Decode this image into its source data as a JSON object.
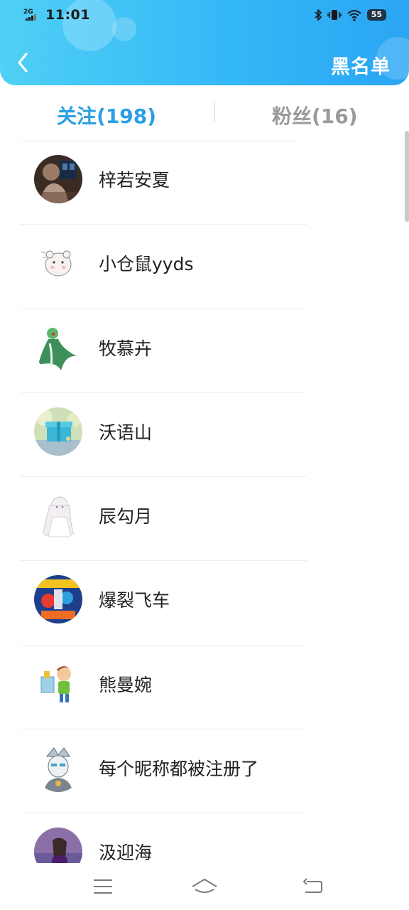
{
  "status_bar": {
    "network": "2G",
    "time": "11:01",
    "battery": "55",
    "icons": [
      "signal-icon",
      "bluetooth-icon",
      "vibrate-icon",
      "wifi-icon",
      "battery-icon"
    ]
  },
  "header": {
    "back_icon": "chevron-left-icon",
    "action_label": "黑名单"
  },
  "tabs": [
    {
      "label": "关注(198)",
      "active": true
    },
    {
      "label": "粉丝(16)",
      "active": false
    }
  ],
  "following": [
    {
      "name": "梓若安夏"
    },
    {
      "name": "小仓鼠yyds"
    },
    {
      "name": "牧慕卉"
    },
    {
      "name": "沃语山"
    },
    {
      "name": "辰勾月"
    },
    {
      "name": "爆裂飞车"
    },
    {
      "name": "熊曼婉"
    },
    {
      "name": "每个昵称都被注册了"
    },
    {
      "name": "汲迎海"
    }
  ],
  "nav": {
    "icons": [
      "menu-icon",
      "home-icon",
      "back-icon"
    ]
  },
  "colors": {
    "header_start": "#4fd0f5",
    "header_end": "#2aa5f4",
    "active_tab": "#2b9fe4",
    "inactive_tab": "#9a9a9a"
  }
}
